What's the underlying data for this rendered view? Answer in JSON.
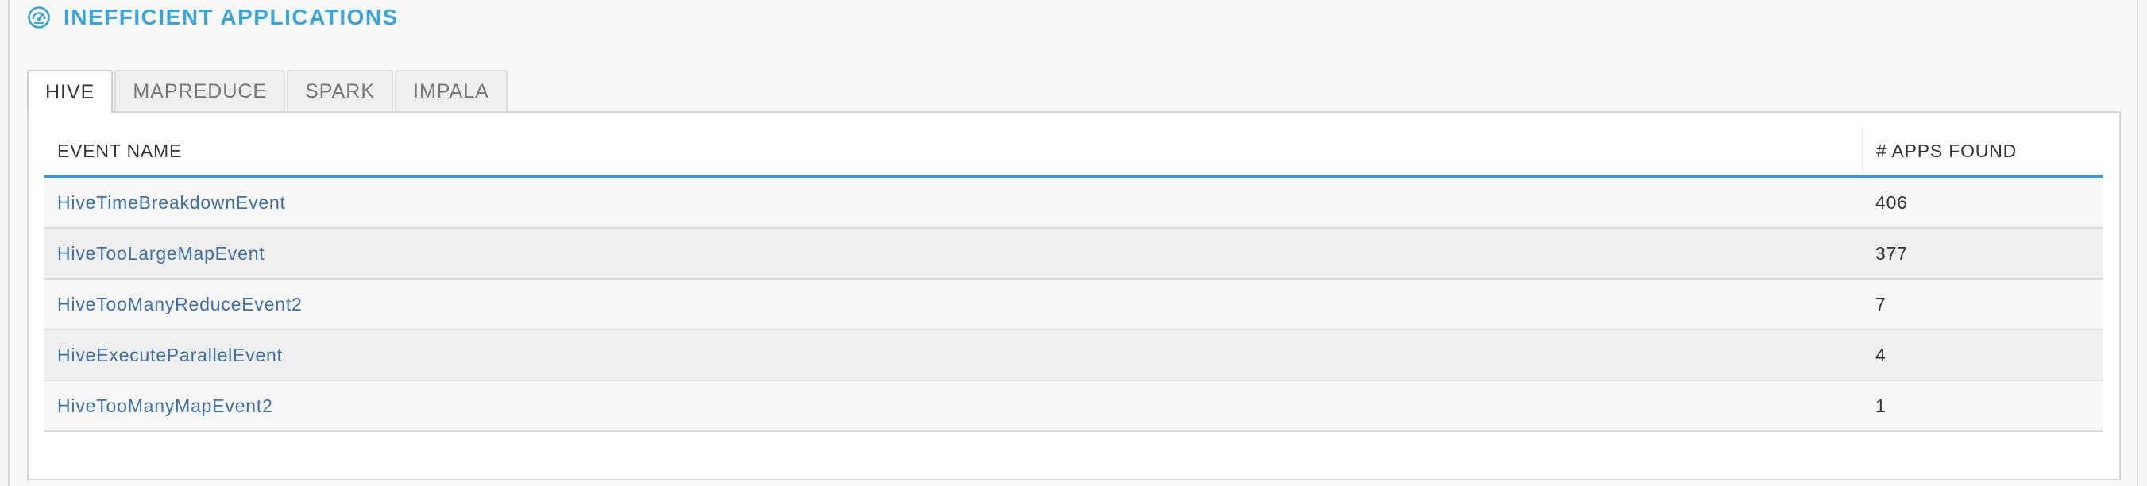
{
  "header": {
    "icon": "speedometer-icon",
    "title": "INEFFICIENT APPLICATIONS",
    "accent_color": "#3aa4e0"
  },
  "tabs": [
    {
      "label": "HIVE",
      "active": true
    },
    {
      "label": "MAPREDUCE",
      "active": false
    },
    {
      "label": "SPARK",
      "active": false
    },
    {
      "label": "IMPALA",
      "active": false
    }
  ],
  "table": {
    "columns": [
      "EVENT NAME",
      "# APPS FOUND"
    ],
    "header_rule_color": "#3a97de",
    "link_color": "#3d6fa8",
    "rows": [
      {
        "event": "HiveTimeBreakdownEvent",
        "count": "406"
      },
      {
        "event": "HiveTooLargeMapEvent",
        "count": "377"
      },
      {
        "event": "HiveTooManyReduceEvent2",
        "count": "7"
      },
      {
        "event": "HiveExecuteParallelEvent",
        "count": "4"
      },
      {
        "event": "HiveTooManyMapEvent2",
        "count": "1"
      }
    ]
  }
}
